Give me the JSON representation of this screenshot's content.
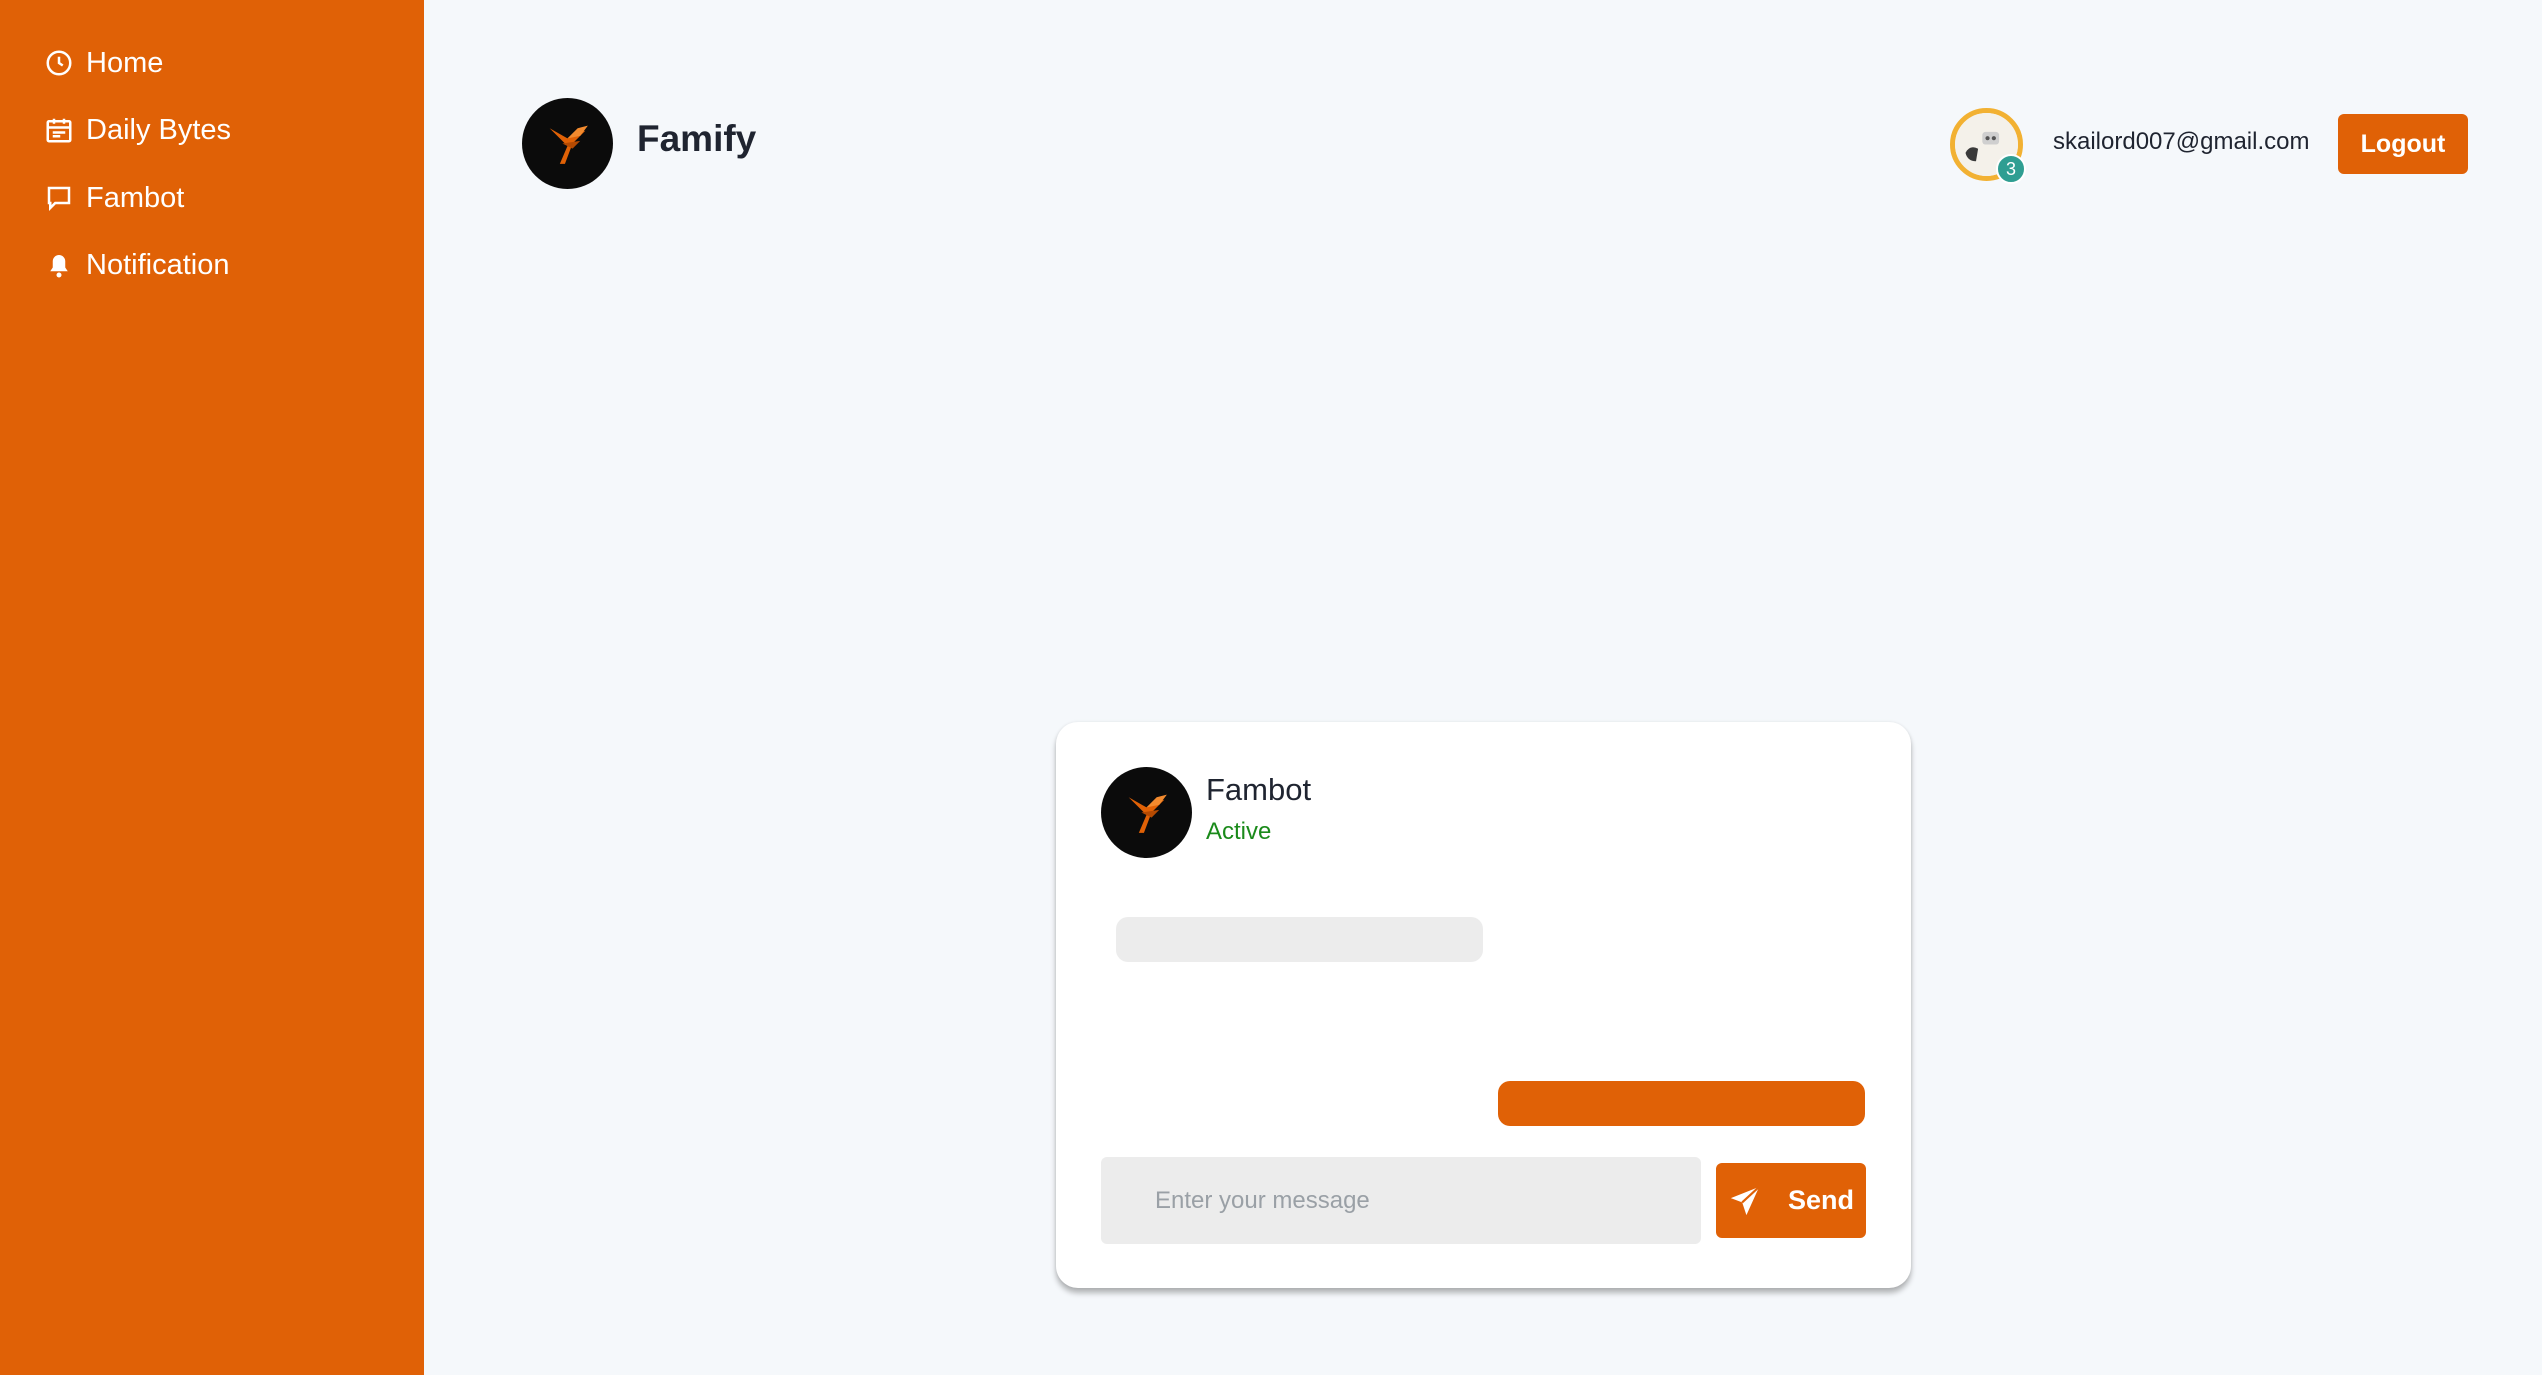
{
  "sidebar": {
    "items": [
      {
        "label": "Home",
        "icon": "clock-icon"
      },
      {
        "label": "Daily Bytes",
        "icon": "calendar-icon"
      },
      {
        "label": "Fambot",
        "icon": "chat-bubble-icon"
      },
      {
        "label": "Notification",
        "icon": "bell-icon"
      }
    ]
  },
  "header": {
    "brand_name": "Famify",
    "user_email": "skailord007@gmail.com",
    "avatar_badge": "3",
    "logout_label": "Logout"
  },
  "chat": {
    "bot_name": "Fambot",
    "bot_status": "Active",
    "input_placeholder": "Enter your message",
    "input_value": "",
    "send_label": "Send"
  },
  "colors": {
    "accent": "#e06106",
    "background": "#f5f8fb",
    "status_active": "#1a8a1a",
    "badge": "#2f9e92"
  }
}
